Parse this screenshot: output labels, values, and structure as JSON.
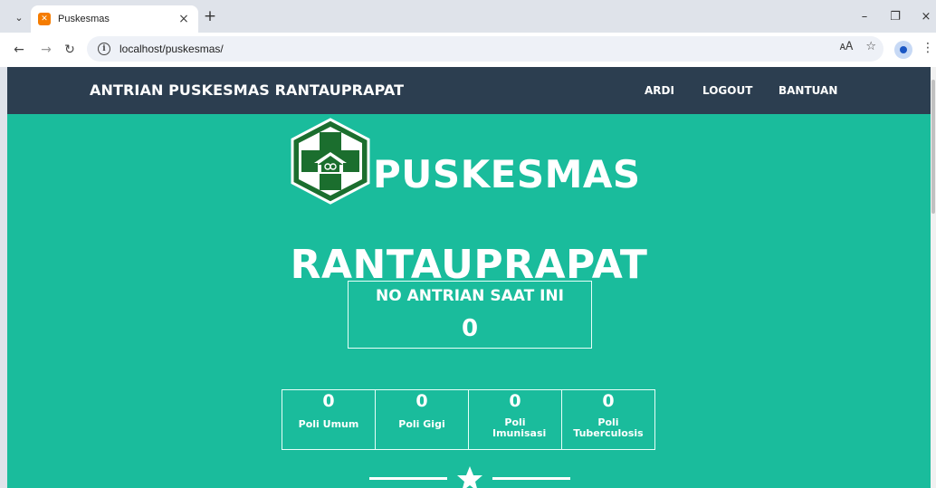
{
  "browser": {
    "tab_title": "Puskesmas",
    "tab_close": "×",
    "new_tab": "+",
    "url": "localhost/puskesmas/",
    "window_controls": [
      "–",
      "❐",
      "×"
    ]
  },
  "site": {
    "brand": "ANTRIAN PUSKESMAS RANTAUPRAPAT",
    "nav_links": [
      "ARDI",
      "LOGOUT",
      "BANTUAN"
    ],
    "logo_word": "PUSKESMAS",
    "headline": "RANTAUPRAPAT",
    "queue_label": "NO ANTRIAN SAAT INI",
    "queue_number": "0",
    "polis": [
      {
        "count": "0",
        "name": "Poli Umum"
      },
      {
        "count": "0",
        "name": "Poli Gigi"
      },
      {
        "count": "0",
        "name": "Poli Imunisasi"
      },
      {
        "count": "0",
        "name": "Poli Tuberculosis"
      }
    ]
  },
  "colors": {
    "nav_bg": "#2c3e50",
    "page_bg": "#1abc9c",
    "logo_green": "#1b6e2e",
    "text": "#ffffff"
  }
}
